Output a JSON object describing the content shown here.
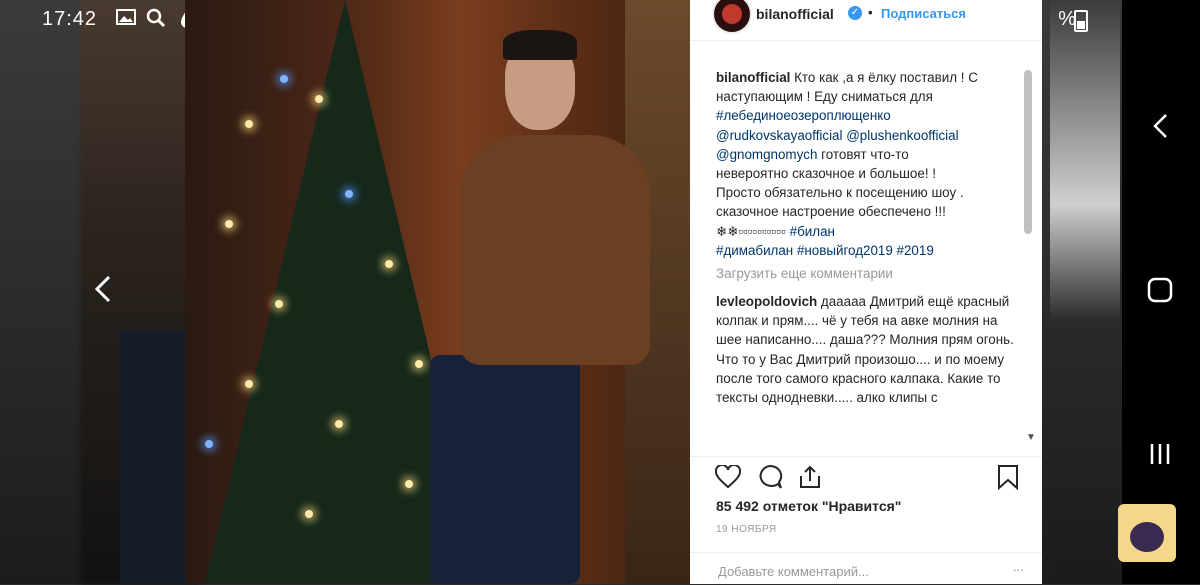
{
  "status_bar": {
    "time": "17:42",
    "icons": [
      "image-icon",
      "search-icon",
      "drop-icon",
      "more-dots-icon"
    ],
    "battery_text": "%"
  },
  "post": {
    "username": "bilanofficial",
    "follow_label": "Подписаться",
    "separator": "•",
    "caption_user": "bilanofficial",
    "caption_lines": [
      " Кто как ,а я ёлку поставил ! С",
      "наступающим ! Еду сниматься для"
    ],
    "hashtag_1": "#лебединоеозероплющенко",
    "mention_1": "@rudkovskayaofficial",
    "mention_2": "@plushenkoofficial",
    "mention_3": "@gnomgnomych",
    "caption_after_mentions": " готовят что-то",
    "caption_lines_2": [
      "невероятно сказочное и большое! !",
      "Просто обязательно к посещению шоу .",
      "сказочное настроение обеспечено !!!"
    ],
    "snowflakes": "❄❄▫▫▫▫▫▫▫▫▫▫",
    "hashtag_bilan": "#билан",
    "hashtag_dimabilan": "#димабилан",
    "hashtag_newyear": "#новыйгод2019",
    "hashtag_2019": "#2019",
    "load_more": "Загрузить еще комментарии",
    "comment_user": "levleopoldovich",
    "comment_text": " дааааа Дмитрий ещё красный колпак и прям.... чё у тебя на авке молния на шее написанно.... даша??? Молния прям огонь. Что то у Вас Дмитрий произошо.... и по моему после того самого красного калпака. Какие то тексты однодневки..... алко клипы с",
    "likes": "85 492 отметок \"Нравится\"",
    "date": "19 НОЯБРЯ",
    "comment_placeholder": "Добавьте комментарий...",
    "more_dots": "..."
  },
  "colors": {
    "accent": "#3897f0",
    "link": "#003569",
    "muted": "#999999"
  }
}
